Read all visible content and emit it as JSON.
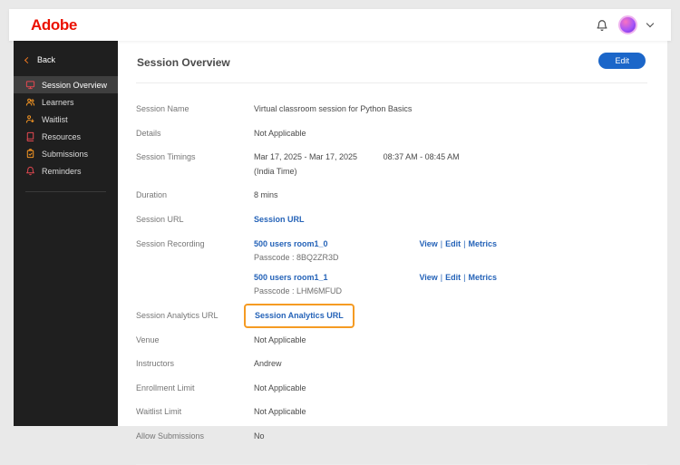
{
  "colors": {
    "brand_red": "#EB1000",
    "link_blue": "#2563B8",
    "edit_button_blue": "#1B66C9",
    "highlight_orange": "#F59B23",
    "sidebar_bg": "#1F1F1F",
    "sidebar_active_bg": "#3F3F3F",
    "icon_orange": "#F29423",
    "icon_red": "#E34850"
  },
  "icons": {
    "separator": "|"
  },
  "header": {
    "brand": "Adobe"
  },
  "sidebar": {
    "back_label": "Back",
    "items": [
      {
        "label": "Session Overview",
        "icon": "session-overview-icon",
        "active": true
      },
      {
        "label": "Learners",
        "icon": "learners-icon",
        "active": false
      },
      {
        "label": "Waitlist",
        "icon": "waitlist-icon",
        "active": false
      },
      {
        "label": "Resources",
        "icon": "resources-icon",
        "active": false
      },
      {
        "label": "Submissions",
        "icon": "submissions-icon",
        "active": false
      },
      {
        "label": "Reminders",
        "icon": "reminders-icon",
        "active": false
      }
    ]
  },
  "main": {
    "title": "Session Overview",
    "edit_button": "Edit",
    "rows": {
      "session_name": {
        "label": "Session Name",
        "value": "Virtual classroom session for Python Basics"
      },
      "details": {
        "label": "Details",
        "value": "Not Applicable"
      },
      "session_timings": {
        "label": "Session Timings",
        "dates": "Mar 17, 2025 - Mar 17, 2025",
        "times": "08:37 AM - 08:45 AM",
        "timezone": "(India Time)"
      },
      "duration": {
        "label": "Duration",
        "value": "8 mins"
      },
      "session_url": {
        "label": "Session URL",
        "link_text": "Session URL"
      },
      "session_recording": {
        "label": "Session Recording",
        "recordings": [
          {
            "name": "500 users room1_0",
            "passcode": "Passcode : 8BQ2ZR3D",
            "actions": [
              "View",
              "Edit",
              "Metrics"
            ]
          },
          {
            "name": "500 users room1_1",
            "passcode": "Passcode : LHM6MFUD",
            "actions": [
              "View",
              "Edit",
              "Metrics"
            ]
          }
        ]
      },
      "session_analytics_url": {
        "label": "Session Analytics URL",
        "link_text": "Session Analytics URL"
      },
      "venue": {
        "label": "Venue",
        "value": "Not Applicable"
      },
      "instructors": {
        "label": "Instructors",
        "value": "Andrew"
      },
      "enrollment_limit": {
        "label": "Enrollment Limit",
        "value": "Not Applicable"
      },
      "waitlist_limit": {
        "label": "Waitlist Limit",
        "value": "Not Applicable"
      },
      "allow_submissions": {
        "label": "Allow Submissions",
        "value": "No"
      }
    }
  }
}
